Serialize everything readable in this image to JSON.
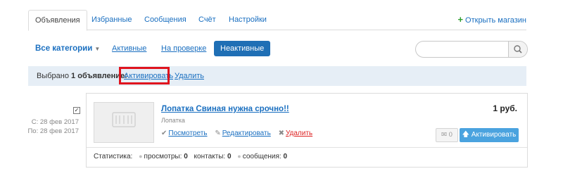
{
  "tabs": [
    {
      "label": "Объявления",
      "active": true
    },
    {
      "label": "Избранные",
      "active": false
    },
    {
      "label": "Сообщения",
      "active": false
    },
    {
      "label": "Счёт",
      "active": false
    },
    {
      "label": "Настройки",
      "active": false
    }
  ],
  "open_store": "Открыть магазин",
  "filters": {
    "all_categories": "Все категории",
    "active": "Активные",
    "moderation": "На проверке",
    "inactive": "Неактивные",
    "search_placeholder": ""
  },
  "selection_bar": {
    "prefix": "Выбрано",
    "count_label": "1 объявление:",
    "activate_link": "Активировать",
    "delete_link": "Удалить"
  },
  "listing": {
    "checked": true,
    "date_from": "С: 28 фев 2017",
    "date_to": "По: 28 фев 2017",
    "title": "Лопатка Свиная нужна срочно!!",
    "category": "Лопатка",
    "action_view": "Посмотреть",
    "action_edit": "Редактировать",
    "action_delete": "Удалить",
    "price": "1 руб.",
    "messages_count": "0",
    "activate_button": "Активировать",
    "stats_label": "Статистика:",
    "views_label": "просмотры:",
    "views_value": "0",
    "contacts_label": "контакты:",
    "contacts_value": "0",
    "messages_label": "сообщения:",
    "messages_value": "0"
  },
  "colors": {
    "primary_button": "#1f6fb5",
    "activate_button": "#4aa3df",
    "link": "#1a6fc0",
    "highlight_box": "#e0141e",
    "selection_bar": "#e6eef6"
  },
  "icons": [
    "plus-icon",
    "chevron-down-icon",
    "search-icon",
    "check-icon",
    "pencil-icon",
    "cross-icon",
    "envelope-icon",
    "arrow-up-icon",
    "eye-icon",
    "speech-bubble-icon"
  ]
}
